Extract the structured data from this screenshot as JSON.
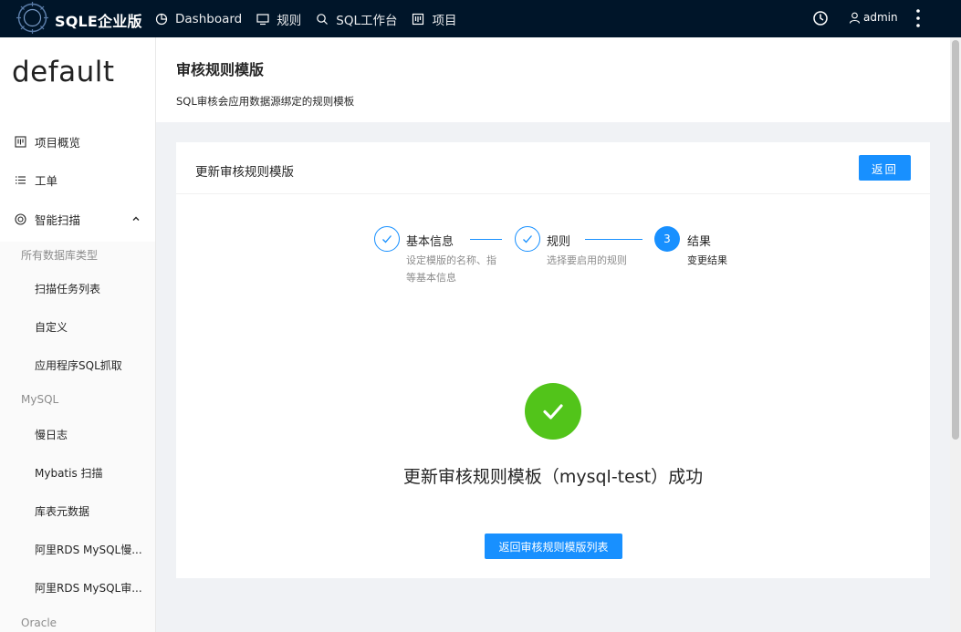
{
  "brand": "SQLE企业版",
  "nav": [
    {
      "label": "Dashboard",
      "icon": "pie-chart-icon"
    },
    {
      "label": "规则",
      "icon": "monitor-icon"
    },
    {
      "label": "SQL工作台",
      "icon": "search-icon"
    },
    {
      "label": "项目",
      "icon": "project-icon"
    }
  ],
  "user": {
    "name": "admin"
  },
  "project": "default",
  "menu": {
    "overview": "项目概览",
    "orders": "工单",
    "scan": "智能扫描",
    "groups": [
      {
        "title": "所有数据库类型",
        "items": [
          "扫描任务列表",
          "自定义",
          "应用程序SQL抓取"
        ]
      },
      {
        "title": "MySQL",
        "items": [
          "慢日志",
          "Mybatis 扫描",
          "库表元数据",
          "阿里RDS MySQL慢...",
          "阿里RDS MySQL审..."
        ]
      },
      {
        "title": "Oracle",
        "items": []
      }
    ]
  },
  "header": {
    "title": "审核规则模版",
    "desc": "SQL审核会应用数据源绑定的规则模板"
  },
  "card": {
    "title": "更新审核规则模版",
    "back": "返回"
  },
  "steps": [
    {
      "title": "基本信息",
      "desc": [
        "设定模版的名称、指",
        "等基本信息"
      ],
      "status": "finished"
    },
    {
      "title": "规则",
      "desc": [
        "选择要启用的规则"
      ],
      "status": "finished"
    },
    {
      "title": "结果",
      "desc": [
        "变更结果"
      ],
      "status": "active",
      "number": "3"
    }
  ],
  "result": {
    "title": "更新审核规则模板（mysql-test）成功",
    "button": "返回审核规则模版列表"
  },
  "colors": {
    "primary": "#1890ff",
    "success": "#52c41a",
    "topbar": "#001529"
  }
}
